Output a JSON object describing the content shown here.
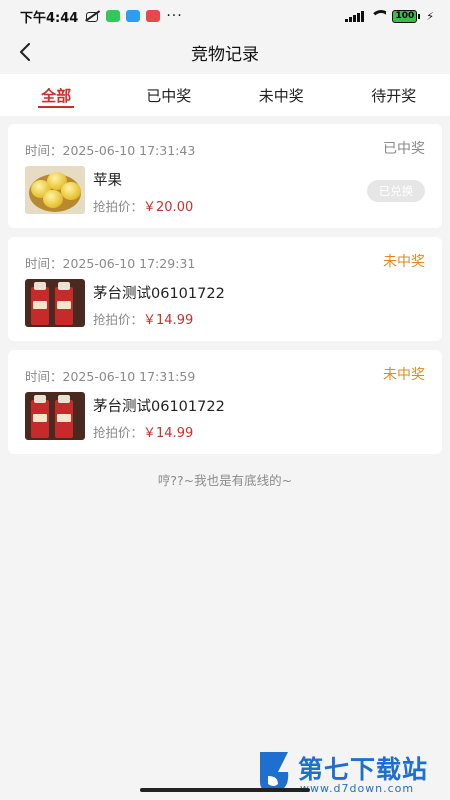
{
  "status_bar": {
    "time": "下午4:44",
    "battery": "100",
    "more": "···"
  },
  "header": {
    "title": "竞物记录",
    "back_icon": "chevron-left-icon"
  },
  "tabs": [
    {
      "label": "全部",
      "active": true
    },
    {
      "label": "已中奖",
      "active": false
    },
    {
      "label": "未中奖",
      "active": false
    },
    {
      "label": "待开奖",
      "active": false
    }
  ],
  "records": [
    {
      "time_label": "时间：",
      "time": "2025-06-10 17:31:43",
      "status": "已中奖",
      "name": "苹果",
      "price_label": "抢拍价：",
      "price": "￥20.00",
      "action": "已兑换",
      "thumb": "apple-image"
    },
    {
      "time_label": "时间：",
      "time": "2025-06-10 17:29:31",
      "status": "未中奖",
      "name": "茅台测试06101722",
      "price_label": "抢拍价：",
      "price": "￥14.99",
      "thumb": "moutai-image"
    },
    {
      "time_label": "时间：",
      "time": "2025-06-10 17:31:59",
      "status": "未中奖",
      "name": "茅台测试06101722",
      "price_label": "抢拍价：",
      "price": "￥14.99",
      "thumb": "moutai-image"
    }
  ],
  "footer_note": "哼??~我也是有底线的~",
  "watermark": {
    "text": "第七下载站",
    "url": "www.d7down.com"
  },
  "colors": {
    "accent": "#c9302c",
    "lost": "#e08a1e",
    "muted": "#8a8a8a",
    "background": "#f4f4f4"
  }
}
